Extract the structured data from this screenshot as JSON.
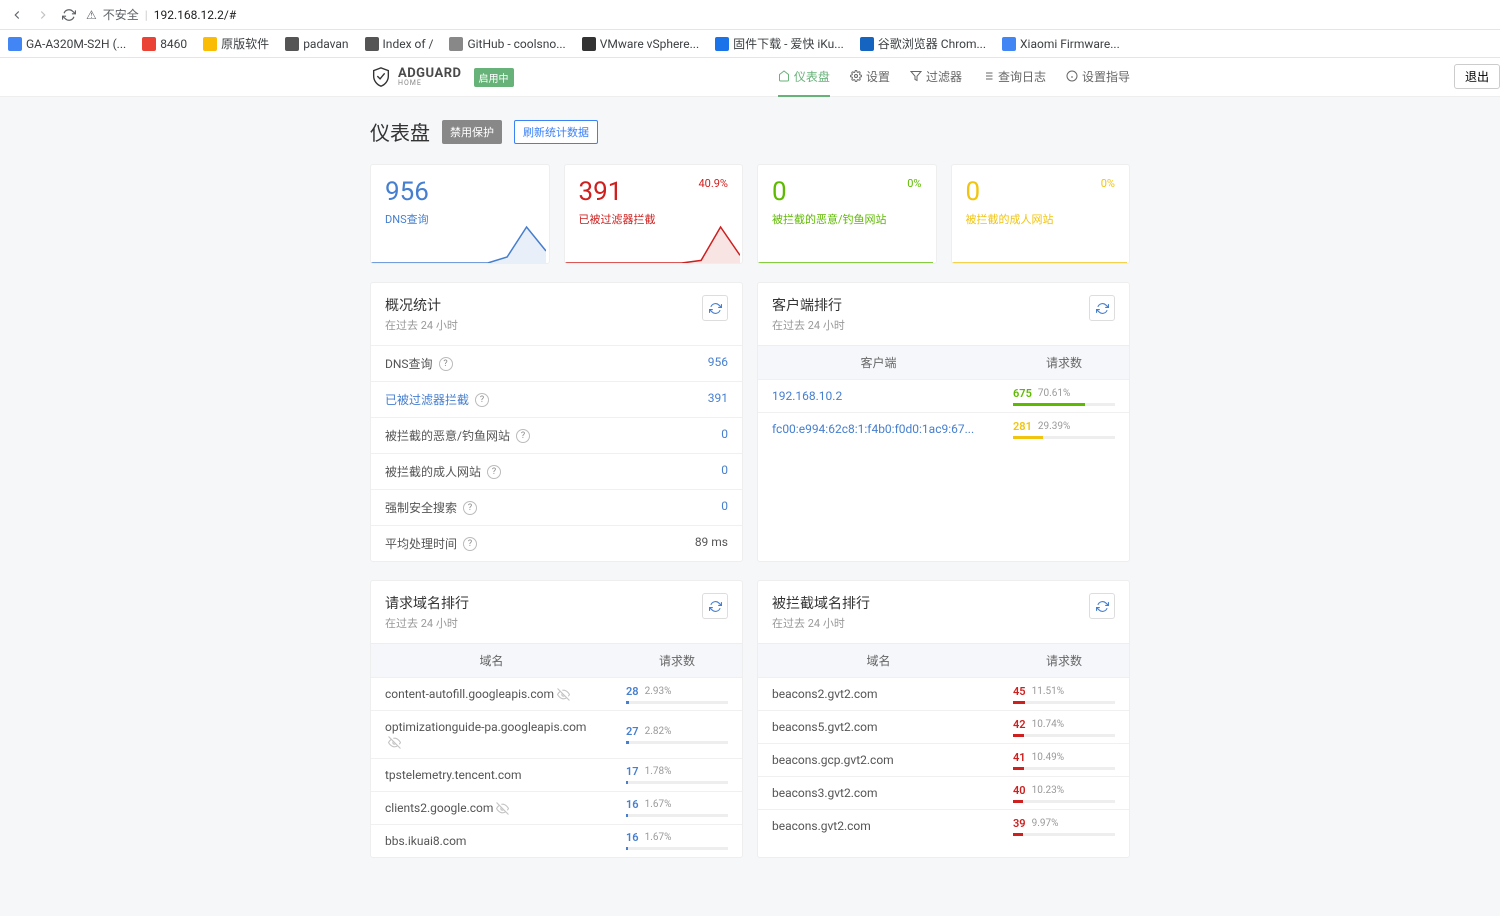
{
  "browser": {
    "url_caption": "不安全",
    "url": "192.168.12.2/#",
    "bookmarks": [
      {
        "label": "GA-A320M-S2H (..."
      },
      {
        "label": "8460"
      },
      {
        "label": "原版软件"
      },
      {
        "label": "padavan"
      },
      {
        "label": "Index of /"
      },
      {
        "label": "GitHub - coolsno..."
      },
      {
        "label": "VMware vSphere..."
      },
      {
        "label": "固件下载 - 爱快 iKu..."
      },
      {
        "label": "谷歌浏览器 Chrom..."
      },
      {
        "label": "Xiaomi Firmware..."
      }
    ]
  },
  "header": {
    "brand1": "ADGUARD",
    "brand2": "HOME",
    "status": "启用中",
    "nav": {
      "dashboard": "仪表盘",
      "settings": "设置",
      "filters": "过滤器",
      "querylog": "查询日志",
      "setup": "设置指导"
    },
    "logout": "退出"
  },
  "page": {
    "title": "仪表盘",
    "btn_disable": "禁用保护",
    "btn_refresh": "刷新统计数据"
  },
  "stats_cards": [
    {
      "value": "956",
      "label": "DNS查询",
      "pct": "",
      "cls": "blue"
    },
    {
      "value": "391",
      "label": "已被过滤器拦截",
      "pct": "40.9%",
      "cls": "red"
    },
    {
      "value": "0",
      "label": "被拦截的恶意/钓鱼网站",
      "pct": "0%",
      "cls": "green"
    },
    {
      "value": "0",
      "label": "被拦截的成人网站",
      "pct": "0%",
      "cls": "yellow"
    }
  ],
  "overview": {
    "title": "概况统计",
    "subtitle": "在过去 24 小时",
    "rows": [
      {
        "label": "DNS查询",
        "value": "956",
        "help": true
      },
      {
        "label": "已被过滤器拦截",
        "value": "391",
        "help": true,
        "link": true
      },
      {
        "label": "被拦截的恶意/钓鱼网站",
        "value": "0",
        "help": true
      },
      {
        "label": "被拦截的成人网站",
        "value": "0",
        "help": true
      },
      {
        "label": "强制安全搜索",
        "value": "0",
        "help": true
      },
      {
        "label": "平均处理时间",
        "value": "89 ms",
        "help": true,
        "plain": true
      }
    ]
  },
  "clients": {
    "title": "客户端排行",
    "subtitle": "在过去 24 小时",
    "col1": "客户端",
    "col2": "请求数",
    "rows": [
      {
        "name": "192.168.10.2",
        "count": "675",
        "pct": "70.61%",
        "w": 71,
        "color": "green"
      },
      {
        "name": "fc00:e994:62c8:1:f4b0:f0d0:1ac9:67...",
        "count": "281",
        "pct": "29.39%",
        "w": 29,
        "color": "yellow"
      }
    ]
  },
  "top_queried": {
    "title": "请求域名排行",
    "subtitle": "在过去 24 小时",
    "col1": "域名",
    "col2": "请求数",
    "rows": [
      {
        "name": "content-autofill.googleapis.com",
        "track": true,
        "count": "28",
        "pct": "2.93%",
        "w": 3
      },
      {
        "name": "optimizationguide-pa.googleapis.com",
        "track": true,
        "count": "27",
        "pct": "2.82%",
        "w": 3
      },
      {
        "name": "tpstelemetry.tencent.com",
        "count": "17",
        "pct": "1.78%",
        "w": 2
      },
      {
        "name": "clients2.google.com",
        "track": true,
        "count": "16",
        "pct": "1.67%",
        "w": 2
      },
      {
        "name": "bbs.ikuai8.com",
        "count": "16",
        "pct": "1.67%",
        "w": 2
      }
    ]
  },
  "top_blocked": {
    "title": "被拦截域名排行",
    "subtitle": "在过去 24 小时",
    "col1": "域名",
    "col2": "请求数",
    "rows": [
      {
        "name": "beacons2.gvt2.com",
        "count": "45",
        "pct": "11.51%",
        "w": 12
      },
      {
        "name": "beacons5.gvt2.com",
        "count": "42",
        "pct": "10.74%",
        "w": 11
      },
      {
        "name": "beacons.gcp.gvt2.com",
        "count": "41",
        "pct": "10.49%",
        "w": 11
      },
      {
        "name": "beacons3.gvt2.com",
        "count": "40",
        "pct": "10.23%",
        "w": 10
      },
      {
        "name": "beacons.gvt2.com",
        "count": "39",
        "pct": "9.97%",
        "w": 10
      }
    ]
  },
  "chart_data": [
    {
      "type": "line",
      "title": "DNS查询 sparkline",
      "values": [
        0,
        0,
        0,
        0,
        0,
        0,
        0,
        5,
        30,
        10
      ],
      "color": "#467fcf"
    },
    {
      "type": "line",
      "title": "已被过滤器拦截 sparkline",
      "values": [
        0,
        0,
        0,
        0,
        0,
        0,
        0,
        2,
        28,
        6
      ],
      "color": "#cd201f"
    },
    {
      "type": "line",
      "title": "恶意/钓鱼 sparkline",
      "values": [
        0,
        0,
        0,
        0,
        0,
        0,
        0,
        0,
        0,
        0
      ],
      "color": "#5eba00"
    },
    {
      "type": "line",
      "title": "成人网站 sparkline",
      "values": [
        0,
        0,
        0,
        0,
        0,
        0,
        0,
        0,
        0,
        0
      ],
      "color": "#f1c40f"
    }
  ]
}
